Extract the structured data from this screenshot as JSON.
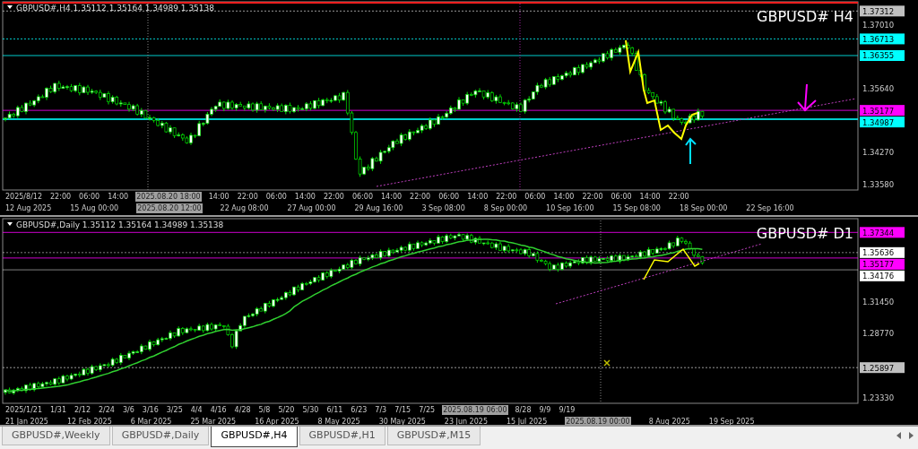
{
  "panels": [
    {
      "title": "GBPUSD#,H4  1.35112 1.35164 1.34989 1.35138",
      "symbol_label": "GBPUSD#  H4",
      "price_ticks": [
        "1.37010",
        "1.35640",
        "1.34270",
        "1.33580"
      ],
      "price_tags": [
        {
          "text": "1.37312",
          "color": "#c0c0c0"
        },
        {
          "text": "1.36713",
          "color": "#00ffff"
        },
        {
          "text": "1.36355",
          "color": "#00ffff"
        },
        {
          "text": "1.35177",
          "color": "#ff00ff"
        },
        {
          "text": "1.34987",
          "color": "#00ffff"
        }
      ],
      "time_row_1": [
        {
          "text": "2025/8/12",
          "highlighted": false
        },
        {
          "text": "22:00",
          "highlighted": false
        },
        {
          "text": "06:00",
          "highlighted": false
        },
        {
          "text": "14:00",
          "highlighted": false
        },
        {
          "text": "2025.08.20 18:00",
          "highlighted": true
        },
        {
          "text": "14:00",
          "highlighted": false
        },
        {
          "text": "22:00",
          "highlighted": false
        },
        {
          "text": "06:00",
          "highlighted": false
        },
        {
          "text": "14:00",
          "highlighted": false
        },
        {
          "text": "22:00",
          "highlighted": false
        },
        {
          "text": "06:00",
          "highlighted": false
        },
        {
          "text": "14:00",
          "highlighted": false
        },
        {
          "text": "22:00",
          "highlighted": false
        },
        {
          "text": "06:00",
          "highlighted": false
        },
        {
          "text": "14:00",
          "highlighted": false
        },
        {
          "text": "22:00",
          "highlighted": false
        },
        {
          "text": "06:00",
          "highlighted": false
        },
        {
          "text": "14:00",
          "highlighted": false
        },
        {
          "text": "22:00",
          "highlighted": false
        },
        {
          "text": "06:00",
          "highlighted": false
        },
        {
          "text": "14:00",
          "highlighted": false
        },
        {
          "text": "22:00",
          "highlighted": false
        }
      ],
      "time_row_2": [
        {
          "text": "12 Aug 2025",
          "highlighted": false
        },
        {
          "text": "15 Aug 00:00",
          "highlighted": false
        },
        {
          "text": "2025.08.20 12:00",
          "highlighted": true
        },
        {
          "text": "22 Aug 08:00",
          "highlighted": false
        },
        {
          "text": "27 Aug 00:00",
          "highlighted": false
        },
        {
          "text": "29 Aug 16:00",
          "highlighted": false
        },
        {
          "text": "3 Sep 08:00",
          "highlighted": false
        },
        {
          "text": "8 Sep 00:00",
          "highlighted": false
        },
        {
          "text": "10 Sep 16:00",
          "highlighted": false
        },
        {
          "text": "15 Sep 08:00",
          "highlighted": false
        },
        {
          "text": "18 Sep 00:00",
          "highlighted": false
        },
        {
          "text": "22 Sep 16:00",
          "highlighted": false
        }
      ]
    },
    {
      "title": "GBPUSD#,Daily  1.35112 1.35164 1.34989 1.35138",
      "symbol_label": "GBPUSD#  D1",
      "price_ticks": [
        "1.31450",
        "1.28770",
        "1.23330"
      ],
      "price_tags": [
        {
          "text": "1.37344",
          "color": "#ff00ff"
        },
        {
          "text": "1.35636",
          "color": "#ffffff"
        },
        {
          "text": "1.35177",
          "color": "#ff00ff"
        },
        {
          "text": "1.34176",
          "color": "#ffffff"
        },
        {
          "text": "1.25897",
          "color": "#c0c0c0"
        }
      ],
      "time_row_1": [
        {
          "text": "2025/1/21",
          "highlighted": false
        },
        {
          "text": "1/31",
          "highlighted": false
        },
        {
          "text": "2/12",
          "highlighted": false
        },
        {
          "text": "2/24",
          "highlighted": false
        },
        {
          "text": "3/6",
          "highlighted": false
        },
        {
          "text": "3/16",
          "highlighted": false
        },
        {
          "text": "3/25",
          "highlighted": false
        },
        {
          "text": "4/4",
          "highlighted": false
        },
        {
          "text": "4/16",
          "highlighted": false
        },
        {
          "text": "4/28",
          "highlighted": false
        },
        {
          "text": "5/8",
          "highlighted": false
        },
        {
          "text": "5/20",
          "highlighted": false
        },
        {
          "text": "5/30",
          "highlighted": false
        },
        {
          "text": "6/11",
          "highlighted": false
        },
        {
          "text": "6/23",
          "highlighted": false
        },
        {
          "text": "7/3",
          "highlighted": false
        },
        {
          "text": "7/15",
          "highlighted": false
        },
        {
          "text": "7/25",
          "highlighted": false
        },
        {
          "text": "2025.08.19 06:00",
          "highlighted": true
        },
        {
          "text": "8/28",
          "highlighted": false
        },
        {
          "text": "9/9",
          "highlighted": false
        },
        {
          "text": "9/19",
          "highlighted": false
        }
      ],
      "time_row_2": [
        {
          "text": "21 Jan 2025",
          "highlighted": false
        },
        {
          "text": "12 Feb 2025",
          "highlighted": false
        },
        {
          "text": "6 Mar 2025",
          "highlighted": false
        },
        {
          "text": "25 Mar 2025",
          "highlighted": false
        },
        {
          "text": "16 Apr 2025",
          "highlighted": false
        },
        {
          "text": "8 May 2025",
          "highlighted": false
        },
        {
          "text": "30 May 2025",
          "highlighted": false
        },
        {
          "text": "23 Jun 2025",
          "highlighted": false
        },
        {
          "text": "15 Jul 2025",
          "highlighted": false
        },
        {
          "text": "2025.08.19 00:00",
          "highlighted": true
        },
        {
          "text": "8 Aug 2025",
          "highlighted": false
        },
        {
          "text": "19 Sep 2025",
          "highlighted": false
        }
      ]
    }
  ],
  "tabs": [
    {
      "label": "GBPUSD#,Weekly",
      "selected": false
    },
    {
      "label": "GBPUSD#,Daily",
      "selected": false
    },
    {
      "label": "GBPUSD#,H4",
      "selected": true
    },
    {
      "label": "GBPUSD#,H1",
      "selected": false
    },
    {
      "label": "GBPUSD#,M15",
      "selected": false
    }
  ]
}
